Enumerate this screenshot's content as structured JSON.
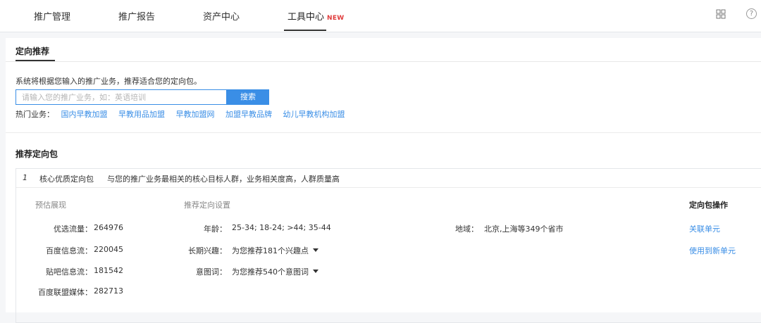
{
  "topnav": {
    "tabs": [
      {
        "label": "推广管理"
      },
      {
        "label": "推广报告"
      },
      {
        "label": "资产中心"
      },
      {
        "label": "工具中心",
        "badge": "NEW"
      }
    ],
    "icons": [
      "grid-icon",
      "help-icon"
    ],
    "help_glyph": "?"
  },
  "section": {
    "tab": "定向推荐",
    "description": "系统将根据您输入的推广业务，推荐适合您的定向包。",
    "search": {
      "placeholder": "请输入您的推广业务，如：英语培训",
      "value": "",
      "button": "搜索"
    },
    "hot": {
      "label": "热门业务：",
      "links": [
        "国内早教加盟",
        "早教用品加盟",
        "早教加盟网",
        "加盟早教品牌",
        "幼儿早教机构加盟"
      ]
    }
  },
  "packages": {
    "title": "推荐定向包",
    "item": {
      "index": "1",
      "name": "核心优质定向包",
      "description": "与您的推广业务最相关的核心目标人群，业务相关度高，人群质量高"
    },
    "columns": {
      "estimate": "预估展现",
      "settings": "推荐定向设置",
      "ops": "定向包操作"
    },
    "estimates": [
      {
        "label": "优选流量：",
        "value": "264976"
      },
      {
        "label": "百度信息流：",
        "value": "220045"
      },
      {
        "label": "贴吧信息流：",
        "value": "181542"
      },
      {
        "label": "百度联盟媒体：",
        "value": "282713"
      }
    ],
    "settings": {
      "age": {
        "label": "年龄：",
        "value": "25-34; 18-24; >44; 35-44"
      },
      "interest": {
        "label": "长期兴趣：",
        "value": "为您推荐181个兴趣点"
      },
      "intent": {
        "label": "意图词：",
        "value": "为您推荐540个意图词"
      },
      "region": {
        "label": "地域：",
        "value": "北京,上海等349个省市"
      }
    },
    "ops": [
      "关联单元",
      "使用到新单元"
    ]
  },
  "colors": {
    "accent": "#3a8ee6",
    "badge": "#e03c3c",
    "text": "#333333"
  }
}
